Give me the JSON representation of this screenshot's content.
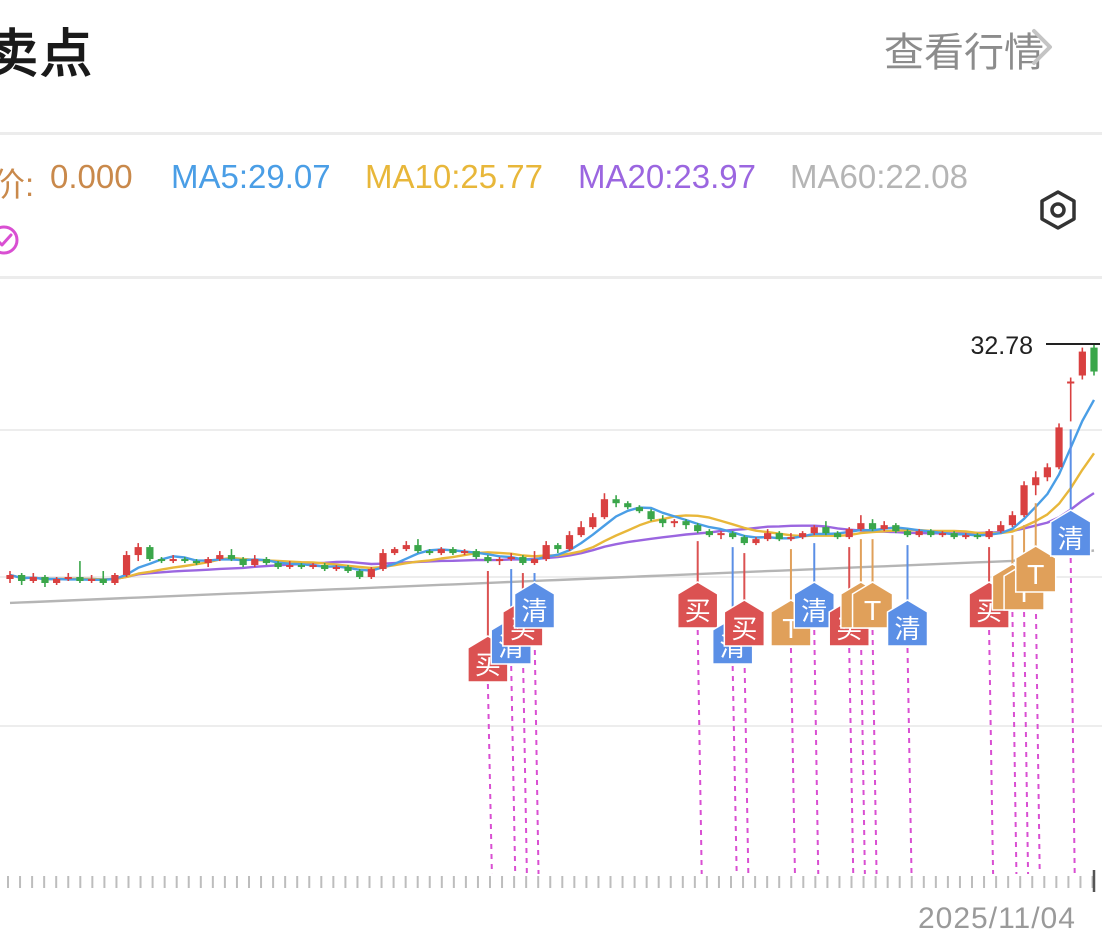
{
  "header": {
    "title": "卖点",
    "view_link": "查看行情"
  },
  "indicators": {
    "price_label": "价:",
    "price_value": "0.000",
    "ma5": "MA5:29.07",
    "ma10": "MA10:25.77",
    "ma20": "MA20:23.97",
    "ma60": "MA60:22.08"
  },
  "colors": {
    "price": "#c9894b",
    "ma5": "#4a9ee6",
    "ma10": "#e8b73a",
    "ma20": "#9b66e0",
    "ma60": "#b5b5b5",
    "up": "#d94040",
    "down": "#3aa64a",
    "buy_marker": "#db5252",
    "clear_marker": "#5b8fe6",
    "t_marker": "#e0a05a",
    "dashed_link": "#d94fd2"
  },
  "x_axis": {
    "last_date": "2025/11/04"
  },
  "chart_data": {
    "type": "candlestick",
    "y_labels": {
      "high": "32.78"
    },
    "ma_latest": {
      "MA5": 29.07,
      "MA10": 25.77,
      "MA20": 23.97,
      "MA60": 22.08
    },
    "candles": [
      {
        "o": 21.0,
        "c": 21.2,
        "h": 21.4,
        "l": 20.8
      },
      {
        "o": 21.2,
        "c": 20.9,
        "h": 21.3,
        "l": 20.7
      },
      {
        "o": 20.9,
        "c": 21.1,
        "h": 21.3,
        "l": 20.8
      },
      {
        "o": 21.1,
        "c": 20.8,
        "h": 21.2,
        "l": 20.6
      },
      {
        "o": 20.8,
        "c": 21.0,
        "h": 21.1,
        "l": 20.7
      },
      {
        "o": 21.0,
        "c": 21.1,
        "h": 21.3,
        "l": 20.9
      },
      {
        "o": 21.1,
        "c": 20.9,
        "h": 21.9,
        "l": 20.8
      },
      {
        "o": 20.9,
        "c": 21.0,
        "h": 21.2,
        "l": 20.8
      },
      {
        "o": 21.0,
        "c": 20.8,
        "h": 21.4,
        "l": 20.7
      },
      {
        "o": 20.8,
        "c": 21.2,
        "h": 21.3,
        "l": 20.7
      },
      {
        "o": 21.2,
        "c": 22.2,
        "h": 22.4,
        "l": 21.1
      },
      {
        "o": 22.2,
        "c": 22.6,
        "h": 22.8,
        "l": 21.9
      },
      {
        "o": 22.6,
        "c": 22.0,
        "h": 22.7,
        "l": 21.9
      },
      {
        "o": 22.0,
        "c": 21.9,
        "h": 22.1,
        "l": 21.8
      },
      {
        "o": 21.9,
        "c": 22.0,
        "h": 22.2,
        "l": 21.8
      },
      {
        "o": 22.0,
        "c": 21.9,
        "h": 22.1,
        "l": 21.8
      },
      {
        "o": 21.9,
        "c": 21.8,
        "h": 22.0,
        "l": 21.7
      },
      {
        "o": 21.8,
        "c": 22.0,
        "h": 22.1,
        "l": 21.6
      },
      {
        "o": 22.0,
        "c": 22.2,
        "h": 22.4,
        "l": 21.9
      },
      {
        "o": 22.2,
        "c": 22.0,
        "h": 22.5,
        "l": 21.9
      },
      {
        "o": 22.0,
        "c": 21.7,
        "h": 22.1,
        "l": 21.6
      },
      {
        "o": 21.7,
        "c": 22.0,
        "h": 22.2,
        "l": 21.6
      },
      {
        "o": 22.0,
        "c": 21.8,
        "h": 22.1,
        "l": 21.7
      },
      {
        "o": 21.8,
        "c": 21.6,
        "h": 21.9,
        "l": 21.5
      },
      {
        "o": 21.6,
        "c": 21.7,
        "h": 21.9,
        "l": 21.5
      },
      {
        "o": 21.7,
        "c": 21.6,
        "h": 21.8,
        "l": 21.5
      },
      {
        "o": 21.6,
        "c": 21.7,
        "h": 21.8,
        "l": 21.5
      },
      {
        "o": 21.7,
        "c": 21.5,
        "h": 21.8,
        "l": 21.4
      },
      {
        "o": 21.5,
        "c": 21.6,
        "h": 21.7,
        "l": 21.4
      },
      {
        "o": 21.6,
        "c": 21.4,
        "h": 21.7,
        "l": 21.3
      },
      {
        "o": 21.4,
        "c": 21.1,
        "h": 21.5,
        "l": 21.0
      },
      {
        "o": 21.1,
        "c": 21.5,
        "h": 21.6,
        "l": 21.0
      },
      {
        "o": 21.5,
        "c": 22.3,
        "h": 22.5,
        "l": 21.4
      },
      {
        "o": 22.3,
        "c": 22.5,
        "h": 22.6,
        "l": 22.2
      },
      {
        "o": 22.5,
        "c": 22.7,
        "h": 22.9,
        "l": 22.4
      },
      {
        "o": 22.7,
        "c": 22.4,
        "h": 23.0,
        "l": 22.3
      },
      {
        "o": 22.4,
        "c": 22.3,
        "h": 22.5,
        "l": 22.2
      },
      {
        "o": 22.3,
        "c": 22.5,
        "h": 22.6,
        "l": 22.2
      },
      {
        "o": 22.5,
        "c": 22.3,
        "h": 22.6,
        "l": 22.2
      },
      {
        "o": 22.3,
        "c": 22.4,
        "h": 22.5,
        "l": 22.2
      },
      {
        "o": 22.4,
        "c": 22.1,
        "h": 22.5,
        "l": 22.0
      },
      {
        "o": 22.1,
        "c": 21.9,
        "h": 22.2,
        "l": 21.8
      },
      {
        "o": 21.9,
        "c": 22.0,
        "h": 22.1,
        "l": 21.7
      },
      {
        "o": 22.0,
        "c": 22.1,
        "h": 22.3,
        "l": 21.9
      },
      {
        "o": 22.1,
        "c": 21.8,
        "h": 22.2,
        "l": 21.7
      },
      {
        "o": 21.8,
        "c": 22.0,
        "h": 22.4,
        "l": 21.7
      },
      {
        "o": 22.0,
        "c": 22.7,
        "h": 22.9,
        "l": 21.9
      },
      {
        "o": 22.7,
        "c": 22.5,
        "h": 22.8,
        "l": 22.3
      },
      {
        "o": 22.5,
        "c": 23.2,
        "h": 23.4,
        "l": 22.4
      },
      {
        "o": 23.2,
        "c": 23.6,
        "h": 23.9,
        "l": 23.1
      },
      {
        "o": 23.6,
        "c": 24.1,
        "h": 24.3,
        "l": 23.5
      },
      {
        "o": 24.1,
        "c": 25.0,
        "h": 25.3,
        "l": 24.0
      },
      {
        "o": 25.0,
        "c": 24.8,
        "h": 25.2,
        "l": 24.6
      },
      {
        "o": 24.8,
        "c": 24.6,
        "h": 24.9,
        "l": 24.5
      },
      {
        "o": 24.6,
        "c": 24.4,
        "h": 24.7,
        "l": 24.3
      },
      {
        "o": 24.4,
        "c": 24.0,
        "h": 24.5,
        "l": 23.9
      },
      {
        "o": 24.0,
        "c": 23.8,
        "h": 24.2,
        "l": 23.6
      },
      {
        "o": 23.8,
        "c": 23.9,
        "h": 24.0,
        "l": 23.6
      },
      {
        "o": 23.9,
        "c": 23.7,
        "h": 24.0,
        "l": 23.5
      },
      {
        "o": 23.7,
        "c": 23.4,
        "h": 23.8,
        "l": 23.3
      },
      {
        "o": 23.4,
        "c": 23.2,
        "h": 23.5,
        "l": 23.1
      },
      {
        "o": 23.2,
        "c": 23.3,
        "h": 23.4,
        "l": 23.0
      },
      {
        "o": 23.3,
        "c": 23.1,
        "h": 23.4,
        "l": 23.0
      },
      {
        "o": 23.1,
        "c": 22.8,
        "h": 23.2,
        "l": 22.7
      },
      {
        "o": 22.8,
        "c": 23.0,
        "h": 23.1,
        "l": 22.7
      },
      {
        "o": 23.0,
        "c": 23.3,
        "h": 23.5,
        "l": 22.9
      },
      {
        "o": 23.3,
        "c": 23.0,
        "h": 23.4,
        "l": 22.9
      },
      {
        "o": 23.0,
        "c": 23.1,
        "h": 23.3,
        "l": 22.9
      },
      {
        "o": 23.1,
        "c": 23.3,
        "h": 23.4,
        "l": 23.0
      },
      {
        "o": 23.3,
        "c": 23.6,
        "h": 23.7,
        "l": 23.2
      },
      {
        "o": 23.6,
        "c": 23.3,
        "h": 23.9,
        "l": 23.2
      },
      {
        "o": 23.3,
        "c": 23.1,
        "h": 23.4,
        "l": 23.0
      },
      {
        "o": 23.1,
        "c": 23.5,
        "h": 23.6,
        "l": 23.0
      },
      {
        "o": 23.5,
        "c": 23.8,
        "h": 24.2,
        "l": 23.4
      },
      {
        "o": 23.8,
        "c": 23.5,
        "h": 24.0,
        "l": 23.4
      },
      {
        "o": 23.5,
        "c": 23.7,
        "h": 23.9,
        "l": 23.4
      },
      {
        "o": 23.7,
        "c": 23.4,
        "h": 23.8,
        "l": 23.3
      },
      {
        "o": 23.4,
        "c": 23.2,
        "h": 23.5,
        "l": 23.1
      },
      {
        "o": 23.2,
        "c": 23.4,
        "h": 23.5,
        "l": 23.1
      },
      {
        "o": 23.4,
        "c": 23.2,
        "h": 23.5,
        "l": 23.1
      },
      {
        "o": 23.2,
        "c": 23.3,
        "h": 23.4,
        "l": 23.1
      },
      {
        "o": 23.3,
        "c": 23.1,
        "h": 23.4,
        "l": 23.0
      },
      {
        "o": 23.1,
        "c": 23.2,
        "h": 23.3,
        "l": 23.0
      },
      {
        "o": 23.2,
        "c": 23.1,
        "h": 23.3,
        "l": 23.0
      },
      {
        "o": 23.1,
        "c": 23.4,
        "h": 23.5,
        "l": 23.0
      },
      {
        "o": 23.4,
        "c": 23.7,
        "h": 23.9,
        "l": 23.3
      },
      {
        "o": 23.7,
        "c": 24.2,
        "h": 24.4,
        "l": 23.6
      },
      {
        "o": 24.2,
        "c": 25.7,
        "h": 25.9,
        "l": 24.1
      },
      {
        "o": 25.7,
        "c": 26.1,
        "h": 26.4,
        "l": 25.2
      },
      {
        "o": 26.1,
        "c": 26.6,
        "h": 26.8,
        "l": 25.9
      },
      {
        "o": 26.6,
        "c": 28.6,
        "h": 28.8,
        "l": 26.5
      },
      {
        "o": 30.9,
        "c": 30.9,
        "h": 31.1,
        "l": 28.9
      },
      {
        "o": 31.2,
        "c": 32.4,
        "h": 32.6,
        "l": 31.0
      },
      {
        "o": 32.6,
        "c": 31.4,
        "h": 32.78,
        "l": 31.2
      }
    ]
  },
  "signals": [
    {
      "label": "买",
      "type": "buy",
      "col": 41,
      "level": 0
    },
    {
      "label": "清",
      "type": "clear",
      "col": 43,
      "level": 1
    },
    {
      "label": "买",
      "type": "buy",
      "col": 44,
      "level": 2
    },
    {
      "label": "清",
      "type": "clear",
      "col": 45,
      "level": 3
    },
    {
      "label": "买",
      "type": "buy",
      "col": 59,
      "level": 3
    },
    {
      "label": "清",
      "type": "clear",
      "col": 62,
      "level": 1
    },
    {
      "label": "买",
      "type": "buy",
      "col": 63,
      "level": 2
    },
    {
      "label": "T",
      "type": "t",
      "col": 67,
      "level": 2
    },
    {
      "label": "清",
      "type": "clear",
      "col": 69,
      "level": 3
    },
    {
      "label": "买",
      "type": "buy",
      "col": 72,
      "level": 2
    },
    {
      "label": "T",
      "type": "t",
      "col": 73,
      "level": 3
    },
    {
      "label": "T",
      "type": "t",
      "col": 74,
      "level": 3
    },
    {
      "label": "清",
      "type": "clear",
      "col": 77,
      "level": 2
    },
    {
      "label": "买",
      "type": "buy",
      "col": 84,
      "level": 3
    },
    {
      "label": "T",
      "type": "t",
      "col": 86,
      "level": 4
    },
    {
      "label": "T",
      "type": "t",
      "col": 87,
      "level": 4
    },
    {
      "label": "T",
      "type": "t",
      "col": 88,
      "level": 5
    },
    {
      "label": "清",
      "type": "clear",
      "col": 91,
      "level": 7
    }
  ]
}
